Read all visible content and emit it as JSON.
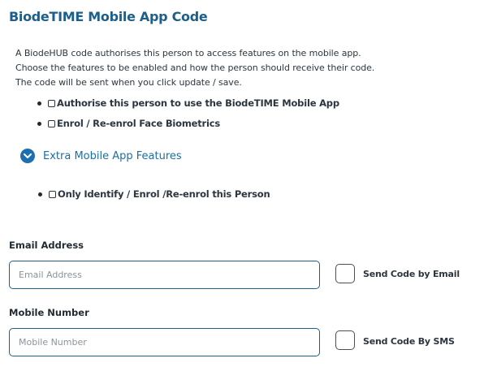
{
  "title": "BiodeTIME Mobile App Code",
  "description": [
    "A BiodeHUB code authorises this person to access features on the mobile app.",
    "Choose the features to be enabled and how the person should receive their code.",
    "The code will be sent when you click update / save."
  ],
  "options": {
    "authorise": "Authorise this person to use the BiodeTIME Mobile App",
    "enrol_face": "Enrol / Re-enrol Face Biometrics"
  },
  "extra": {
    "label": "Extra Mobile App Features",
    "icon": "chevron-down-icon",
    "options": {
      "only_identify": "Only Identify / Enrol /Re-enrol this Person"
    }
  },
  "email": {
    "label": "Email Address",
    "placeholder": "Email Address",
    "value": "",
    "send_label": "Send Code by Email",
    "send_checked": false
  },
  "mobile": {
    "label": "Mobile Number",
    "placeholder": "Mobile Number",
    "value": "",
    "send_label": "Send Code By SMS",
    "send_checked": false
  },
  "colors": {
    "title": "#1d5e8a",
    "accent": "#1d6fb3",
    "input_border": "#1d5e8a"
  }
}
